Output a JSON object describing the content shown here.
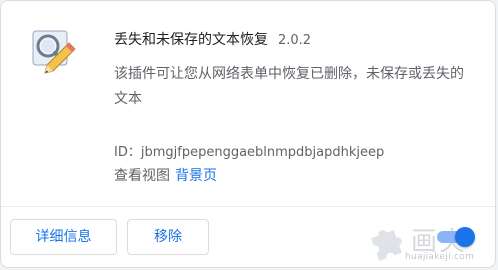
{
  "extension": {
    "icon": "magnifier-pencil-icon",
    "name": "丢失和未保存的文本恢复",
    "version": "2.0.2",
    "description": "该插件可让您从网络表单中恢复已删除，未保存或丢失的文本",
    "id_label": "ID：",
    "id_value": "jbmgjfpepenggaeblnmpdbjapdhkjeep",
    "inspect_views_label": "查看视图",
    "background_page_link": "背景页"
  },
  "actions": {
    "details_label": "详细信息",
    "remove_label": "移除",
    "enabled": true
  },
  "watermark": {
    "logo_text": "画夹",
    "site_text": "huajiakeji.com",
    "icon": "puzzle-icon"
  },
  "colors": {
    "accent": "#1a73e8",
    "toggle_track": "#8ab4f8",
    "text_primary": "#202124",
    "text_secondary": "#5f6368",
    "border": "#dadce0"
  }
}
